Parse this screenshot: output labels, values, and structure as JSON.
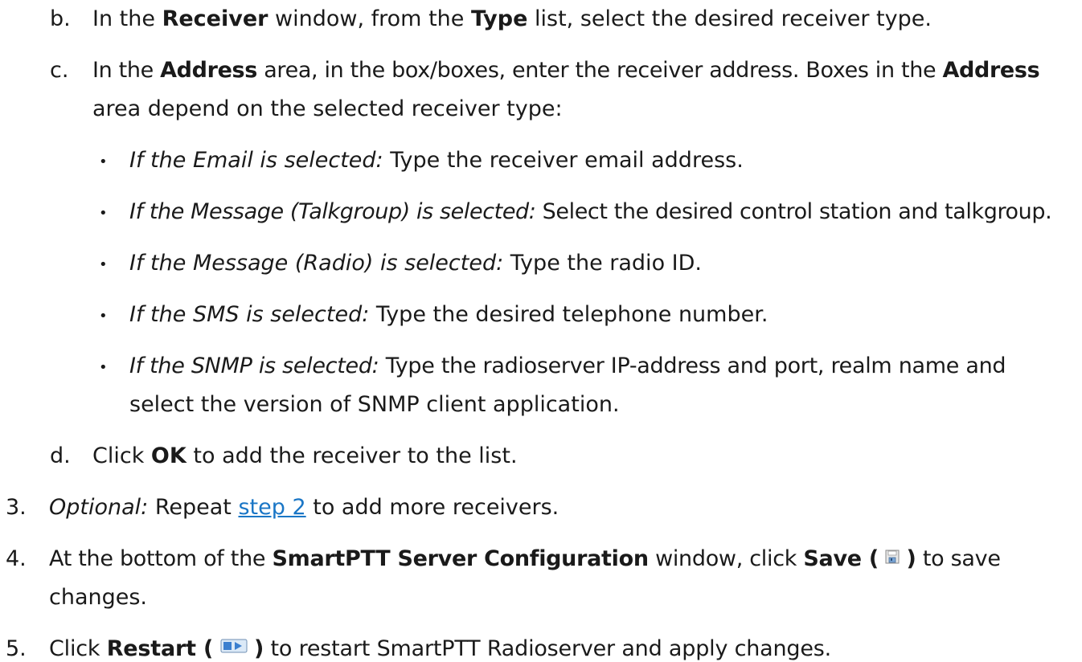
{
  "sub_steps": [
    {
      "marker": "b.",
      "parts": [
        "In the ",
        "Receiver",
        " window, from the ",
        "Type",
        " list, select the desired receiver type."
      ]
    },
    {
      "marker": "c.",
      "line1": [
        "In the ",
        "Address",
        " area, in the box/boxes, enter the receiver address. Boxes in the ",
        "Address"
      ],
      "line2": "area depend on the selected receiver type:"
    },
    {
      "marker": "d.",
      "parts": [
        "Click ",
        "OK",
        " to add the receiver to the list."
      ]
    }
  ],
  "bullets": [
    {
      "lead": "If the Email is selected:",
      "text": " Type the receiver email address."
    },
    {
      "lead": "If the Message (Talkgroup) is selected:",
      "text": " Select the desired control station and talkgroup."
    },
    {
      "lead": "If the Message (Radio) is selected:",
      "text": " Type the radio ID."
    },
    {
      "lead": "If the SMS is selected:",
      "text": " Type the desired telephone number."
    },
    {
      "lead": "If the SNMP is selected:",
      "text": " Type the radioserver IP-address and port, realm name and",
      "line2": "select the version of SNMP client application."
    }
  ],
  "steps": [
    {
      "marker": "3.",
      "lead": "Optional:",
      "text1": " Repeat ",
      "link": "step 2",
      "text2": " to add more receivers."
    },
    {
      "marker": "4.",
      "text1": "At the bottom of the ",
      "bold1": "SmartPTT Server Configuration",
      "text2": " window, click ",
      "bold2": "Save (",
      "bold3": ")",
      "text3": " to save",
      "line2": "changes.",
      "icon": "save-icon"
    },
    {
      "marker": "5.",
      "text1": "Click ",
      "bold1": "Restart (",
      "bold2": ")",
      "text2": " to restart SmartPTT Radioserver and apply changes.",
      "icon": "restart-icon"
    }
  ],
  "colors": {
    "link": "#1a76c6",
    "text": "#1a1a1a"
  }
}
